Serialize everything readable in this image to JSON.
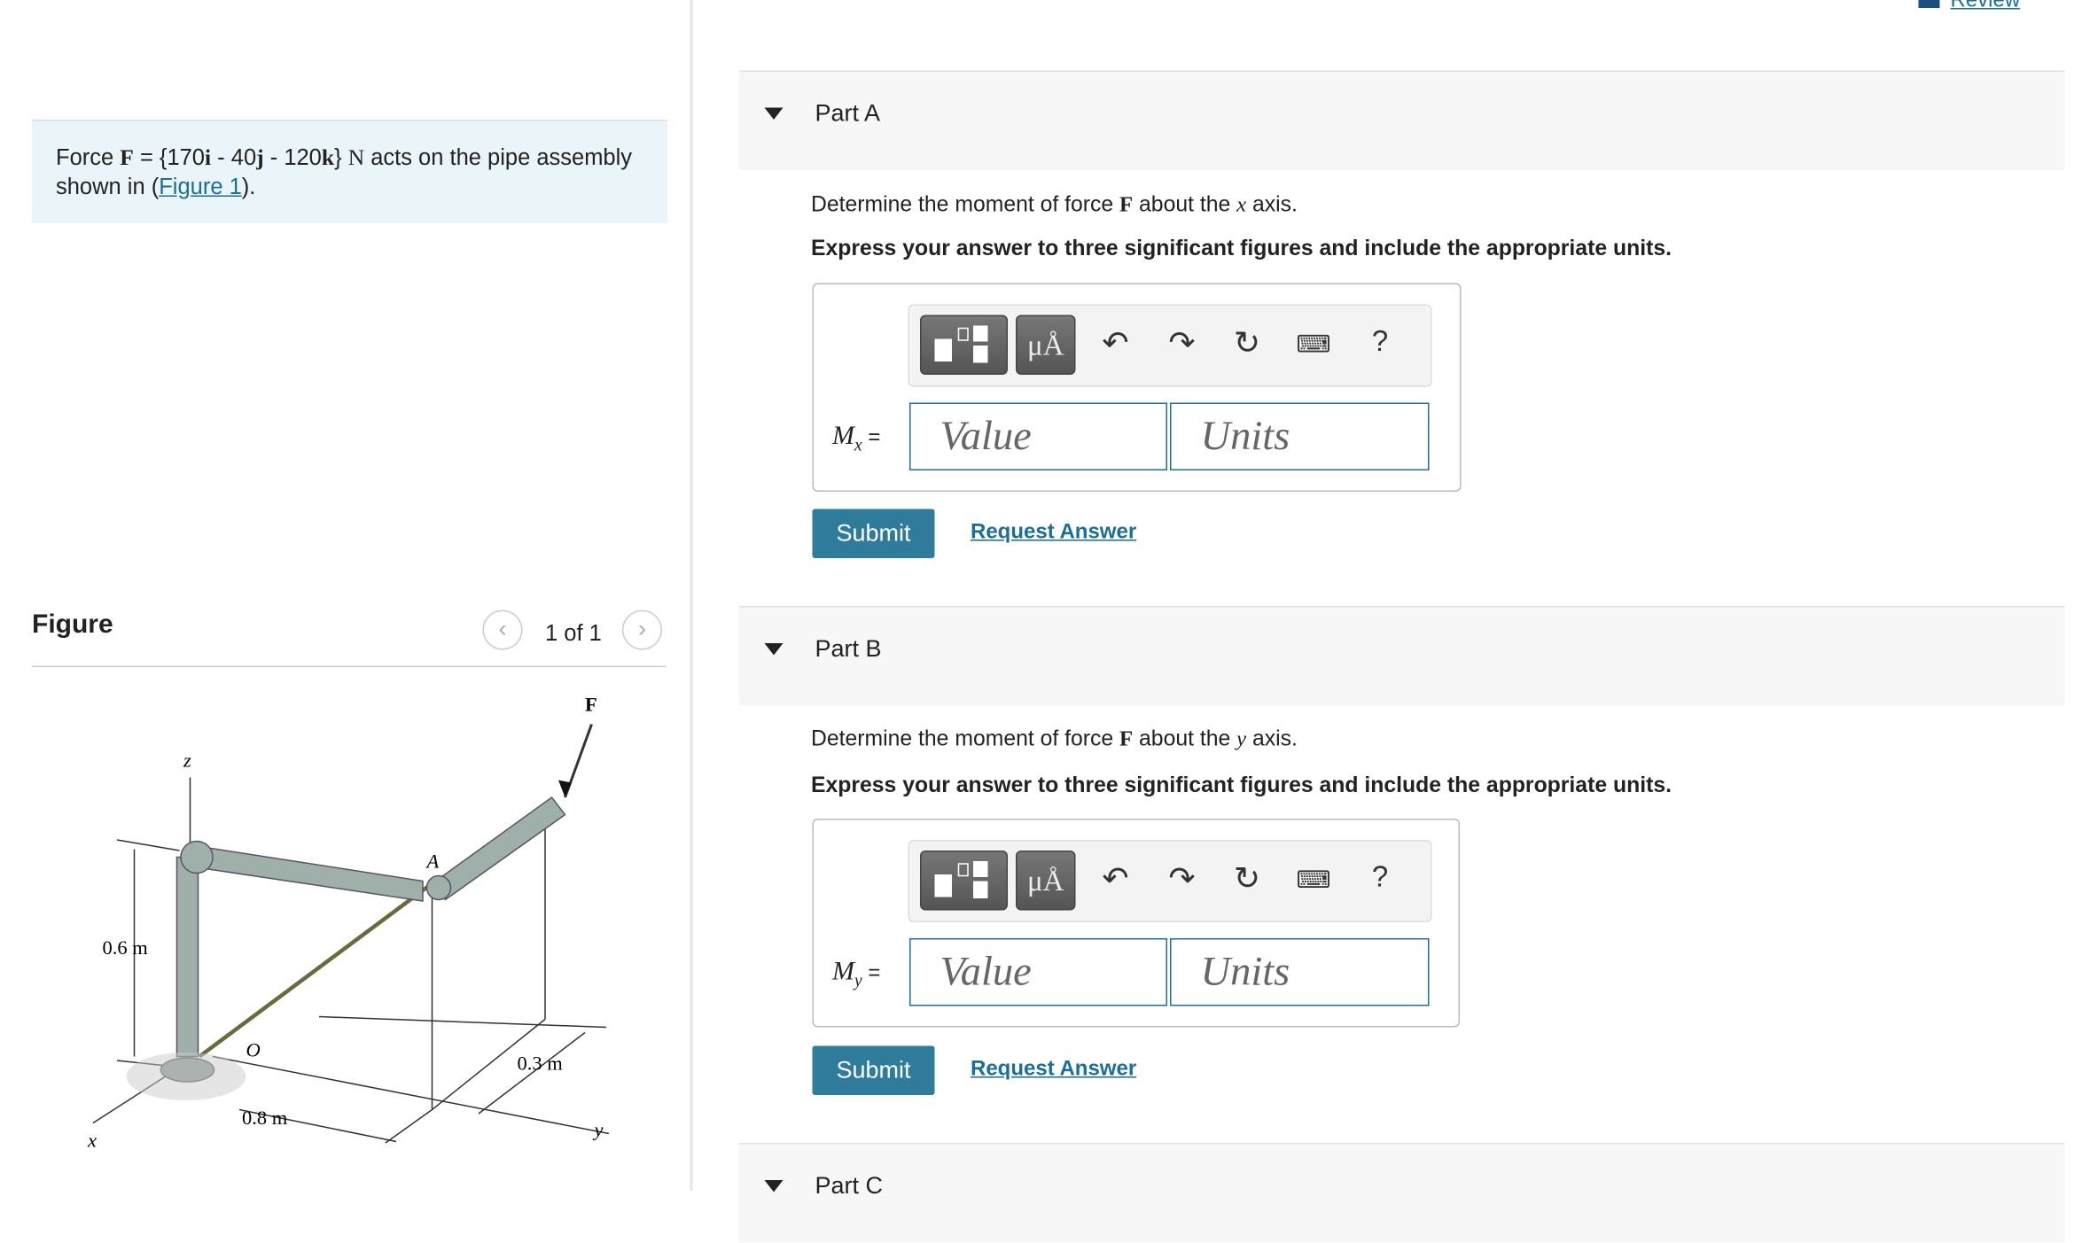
{
  "problem": {
    "prefix": "Force ",
    "F": "F",
    "eq": " = {170",
    "i": "i",
    "m1": " - 40",
    "j": "j",
    "m2": " - 120",
    "k": "k",
    "close": "} ",
    "N": "N",
    "suffix": " acts on the pipe assembly shown in (",
    "figure_link": "Figure 1",
    "end": ")."
  },
  "review_link": "Review",
  "figure": {
    "title": "Figure",
    "pager": "1 of 1",
    "prev_icon": "chevron-left-icon",
    "next_icon": "chevron-right-icon",
    "labels": {
      "F": "F",
      "z": "z",
      "A": "A",
      "O": "O",
      "h": "0.6 m",
      "d": "0.3 m",
      "w": "0.8 m",
      "x": "x",
      "y": "y"
    }
  },
  "parts": [
    {
      "label": "Part A",
      "q_pre": "Determine the moment of force ",
      "q_F": "F",
      "q_mid": " about the ",
      "q_axis": "x",
      "q_post": " axis.",
      "instruction": "Express your answer to three significant figures and include the appropriate units.",
      "var": "M",
      "sub": "x",
      "eq": " =",
      "value_placeholder": "Value",
      "units_placeholder": "Units",
      "submit": "Submit",
      "request": "Request Answer"
    },
    {
      "label": "Part B",
      "q_pre": "Determine the moment of force ",
      "q_F": "F",
      "q_mid": " about the ",
      "q_axis": "y",
      "q_post": " axis.",
      "instruction": "Express your answer to three significant figures and include the appropriate units.",
      "var": "M",
      "sub": "y",
      "eq": " =",
      "value_placeholder": "Value",
      "units_placeholder": "Units",
      "submit": "Submit",
      "request": "Request Answer"
    },
    {
      "label": "Part C"
    }
  ],
  "toolbar": {
    "units_btn": "μÅ",
    "help": "?",
    "icons": [
      "templates-icon",
      "units-icon",
      "undo-icon",
      "redo-icon",
      "reset-icon",
      "keyboard-icon",
      "help-icon"
    ]
  },
  "colors": {
    "accent": "#2e7b9c",
    "link": "#1a6e9a",
    "info_bg": "#e9f5f8",
    "input_border": "#1d6fa5"
  }
}
